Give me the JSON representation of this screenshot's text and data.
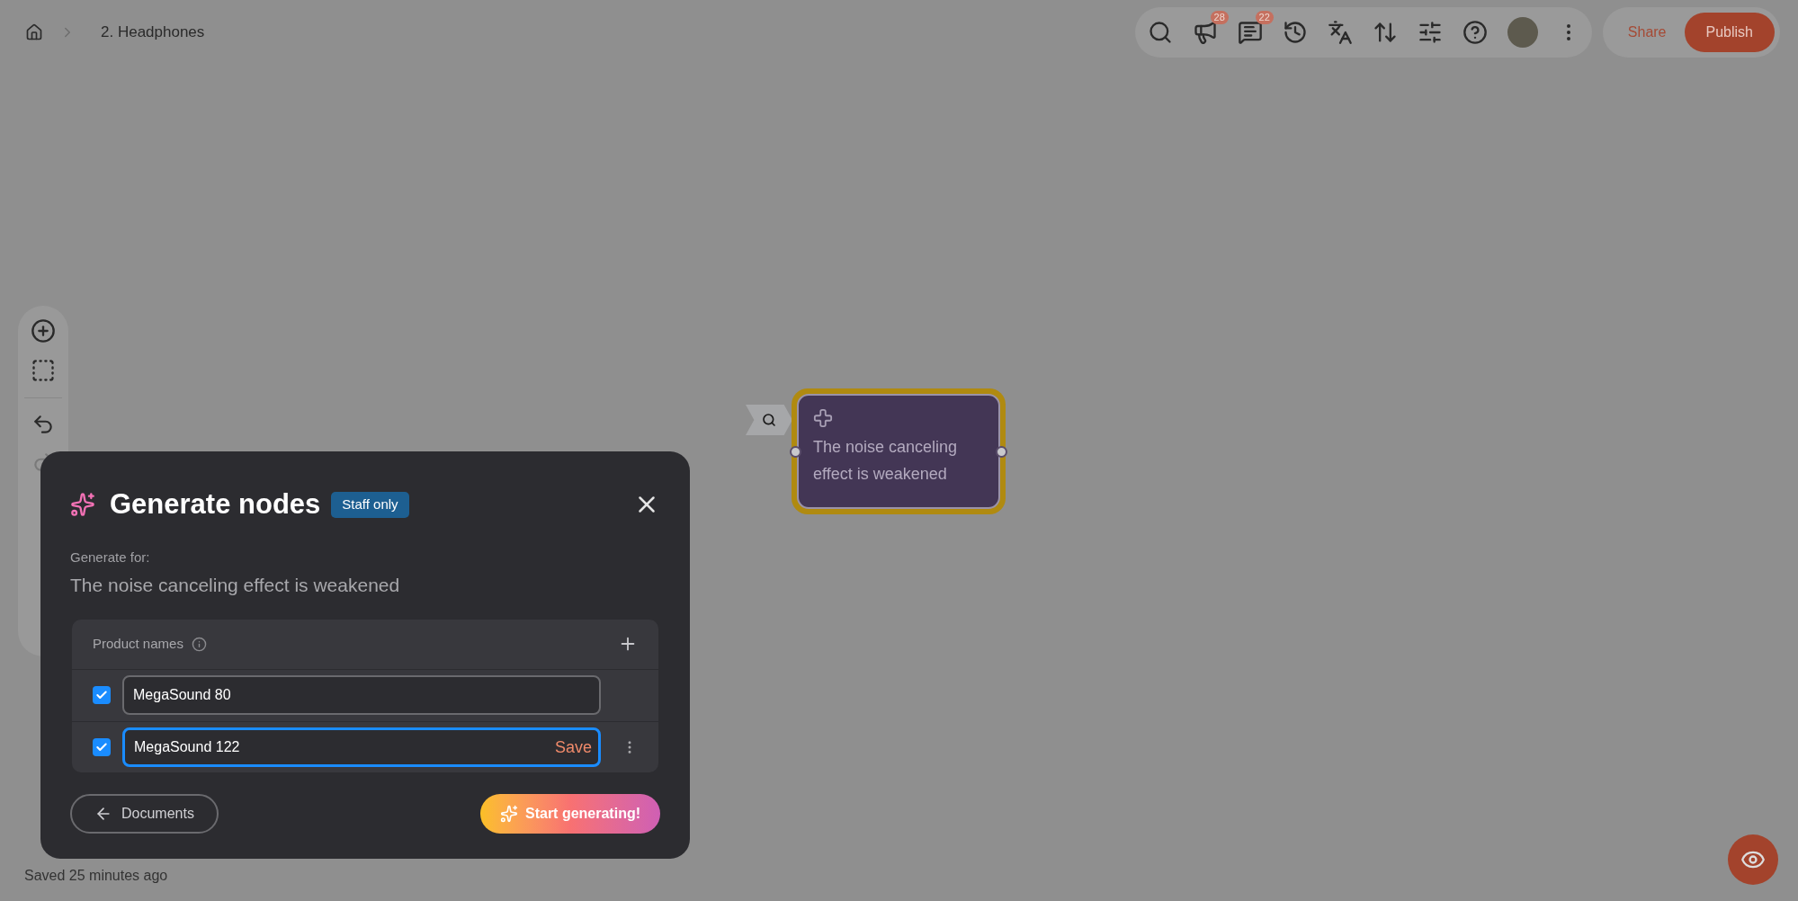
{
  "breadcrumb": {
    "items": [
      {
        "label": "2. Headphones"
      }
    ]
  },
  "toolbar": {
    "badges": [
      {
        "kind": "announcements",
        "count": "28"
      },
      {
        "kind": "comments",
        "count": "22"
      }
    ],
    "share": "Share",
    "publish": "Publish"
  },
  "node": {
    "text": "The noise canceling effect is weakened",
    "selected": true
  },
  "dialog": {
    "title": "Generate nodes",
    "badge": "Staff only",
    "for_label": "Generate for:",
    "target": "The noise canceling effect is weakened",
    "section": "Product names",
    "rows": [
      {
        "value": "MegaSound 80",
        "checked": true,
        "focused": false
      },
      {
        "value": "MegaSound 122",
        "checked": true,
        "focused": true,
        "action": "Save"
      }
    ],
    "back": "Documents",
    "start": "Start generating!"
  },
  "status": "Saved 25 minutes ago"
}
